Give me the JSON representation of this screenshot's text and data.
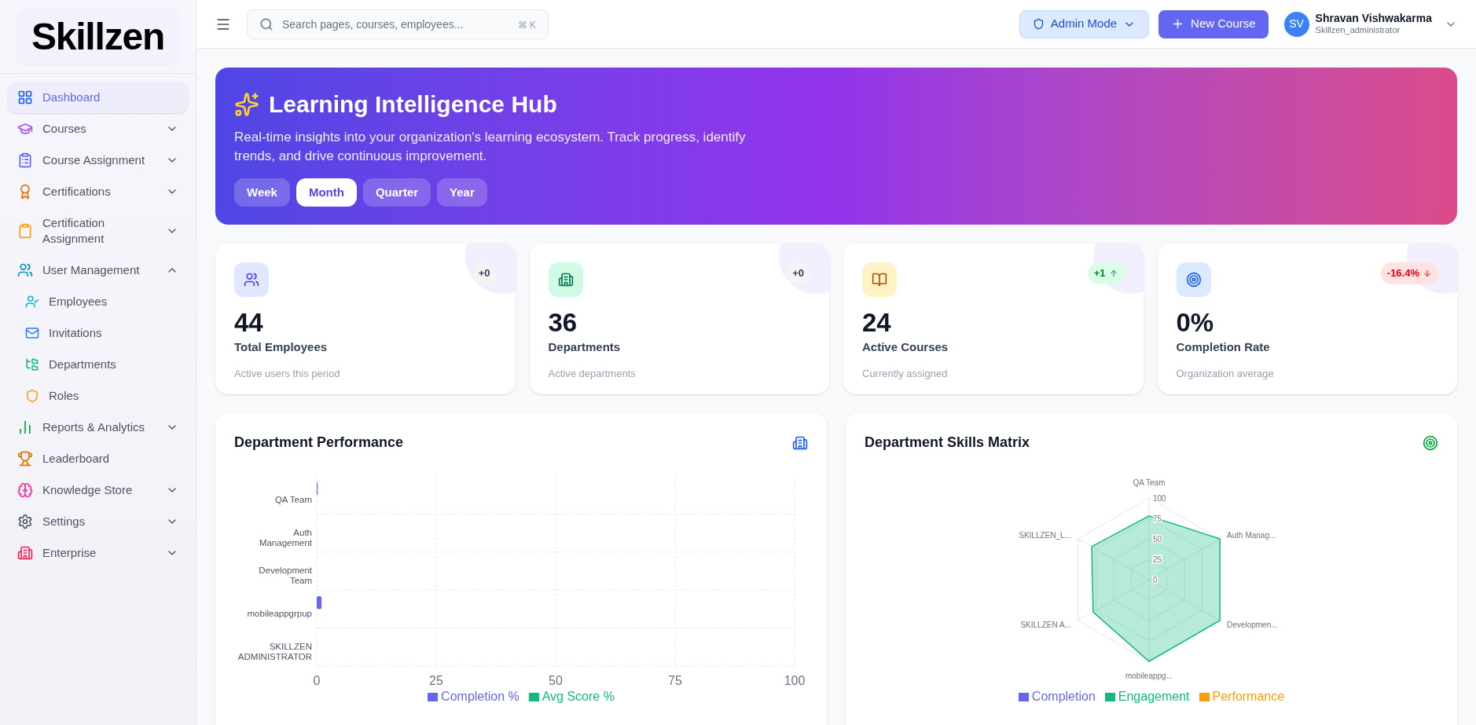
{
  "logo": {
    "text": "Skillzen"
  },
  "sidebar": {
    "items": [
      {
        "label": "Dashboard",
        "kind": "link",
        "selected": true
      },
      {
        "label": "Courses",
        "kind": "group",
        "expanded": false,
        "selected": false
      },
      {
        "label": "Course Assignment",
        "kind": "group",
        "expanded": false,
        "selected": false
      },
      {
        "label": "Certifications",
        "kind": "group",
        "expanded": false,
        "selected": false
      },
      {
        "label": "Certification Assignment",
        "kind": "group",
        "expanded": false,
        "selected": false
      },
      {
        "label": "User Management",
        "kind": "group",
        "expanded": true,
        "selected": false,
        "children": [
          {
            "label": "Employees",
            "selected": false
          },
          {
            "label": "Invitations",
            "selected": false
          },
          {
            "label": "Departments",
            "selected": false
          },
          {
            "label": "Roles",
            "selected": false
          }
        ]
      },
      {
        "label": "Reports & Analytics",
        "kind": "group",
        "expanded": false,
        "selected": false
      },
      {
        "label": "Leaderboard",
        "kind": "link",
        "selected": false
      },
      {
        "label": "Knowledge Store",
        "kind": "group",
        "expanded": false,
        "selected": false
      },
      {
        "label": "Settings",
        "kind": "group",
        "expanded": false,
        "selected": false
      },
      {
        "label": "Enterprise",
        "kind": "group",
        "expanded": false,
        "selected": false
      }
    ]
  },
  "topbar": {
    "search": {
      "placeholder": "Search pages, courses, employees...",
      "shortcut": "⌘ K"
    },
    "mode_button": "Admin Mode",
    "new_button": "New Course",
    "user": {
      "initials": "SV",
      "name": "Shravan Vishwakarma",
      "role": "Skillzen_administrator"
    }
  },
  "hero": {
    "title": "Learning Intelligence Hub",
    "subtitle": "Real-time insights into your organization's learning ecosystem. Track progress, identify trends, and drive continuous improvement.",
    "periods": [
      {
        "label": "Week",
        "selected": false
      },
      {
        "label": "Month",
        "selected": true
      },
      {
        "label": "Quarter",
        "selected": false
      },
      {
        "label": "Year",
        "selected": false
      }
    ]
  },
  "stats": [
    {
      "value": "44",
      "label": "Total Employees",
      "note": "Active users this period",
      "delta": "+0",
      "kind": "neutral"
    },
    {
      "value": "36",
      "label": "Departments",
      "note": "Active departments",
      "delta": "+0",
      "kind": "neutral"
    },
    {
      "value": "24",
      "label": "Active Courses",
      "note": "Currently assigned",
      "delta": "+1",
      "kind": "up"
    },
    {
      "value": "0%",
      "label": "Completion Rate",
      "note": "Organization average",
      "delta": "-16.4%",
      "kind": "down"
    }
  ],
  "performance": {
    "title": "Department Performance",
    "chart_data": {
      "type": "bar",
      "orientation": "horizontal",
      "grid": true,
      "categories": [
        "QA Team",
        "Auth Management",
        "Development Team",
        "mobileappgrpup",
        "SKILLZEN ADMINISTRATOR"
      ],
      "series": [
        {
          "name": "Completion %",
          "color": "#6366f1",
          "values": [
            0.2,
            0,
            0,
            1,
            0
          ]
        },
        {
          "name": "Avg Score %",
          "color": "#10b981",
          "values": [
            0,
            0,
            0,
            0,
            0
          ]
        }
      ],
      "xlim": [
        0,
        100
      ],
      "xticks": [
        0,
        25,
        50,
        75,
        100
      ]
    }
  },
  "skills": {
    "title": "Department Skills Matrix",
    "chart_data": {
      "type": "radar",
      "categories": [
        "QA Team",
        "Auth Manag...",
        "Developmen...",
        "mobileappg...",
        "SKILLZEN A...",
        "SKILLZEN_L..."
      ],
      "series": [
        {
          "color": "#10b981",
          "values": [
            78,
            100,
            100,
            100,
            79,
            81
          ]
        }
      ],
      "ylim": [
        0,
        100
      ],
      "yticks": [
        0,
        25,
        50,
        75,
        100
      ]
    },
    "legend": [
      {
        "name": "Completion",
        "color": "#6366f1"
      },
      {
        "name": "Engagement",
        "color": "#10b981"
      },
      {
        "name": "Performance",
        "color": "#f59e0b"
      }
    ]
  }
}
